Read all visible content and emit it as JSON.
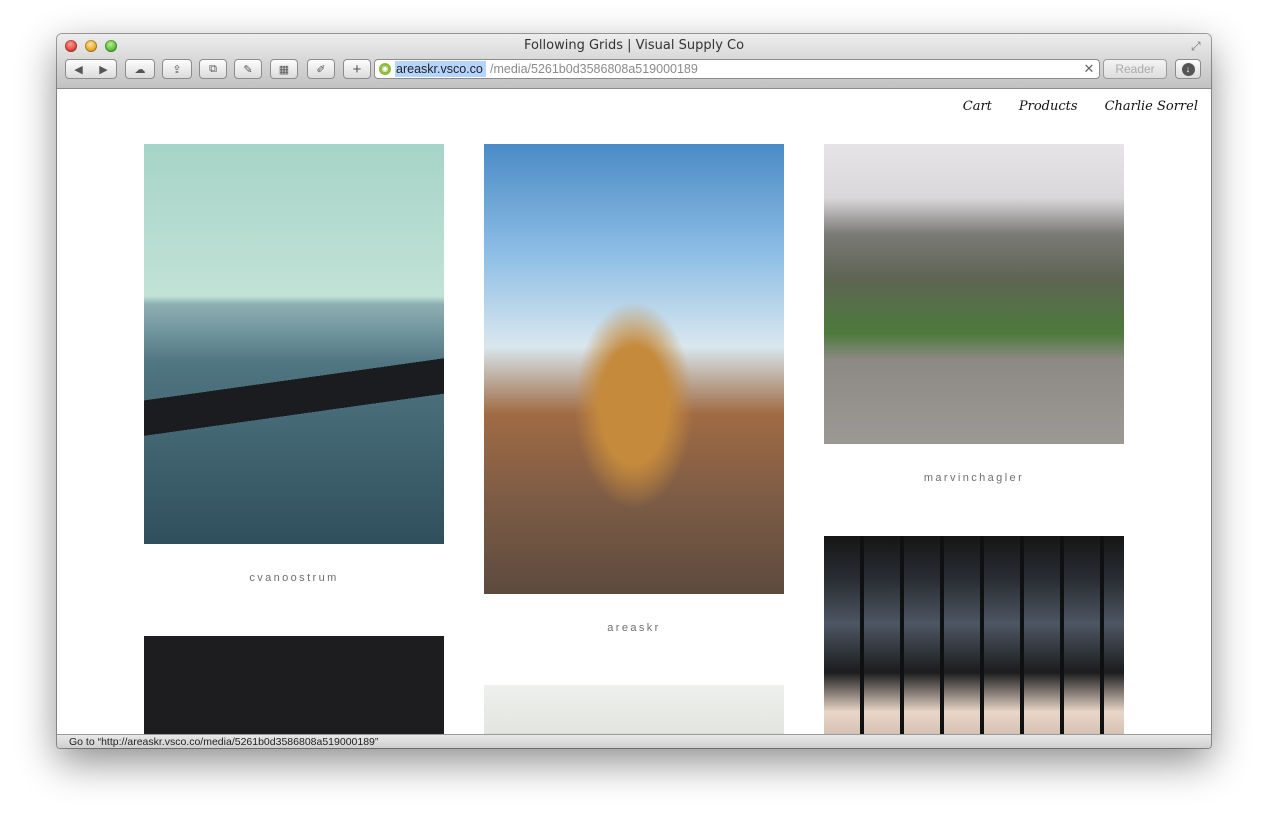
{
  "window": {
    "title": "Following Grids | Visual Supply Co",
    "fullscreen_icon": "fullscreen-icon"
  },
  "toolbar": {
    "back_icon": "◀",
    "forward_icon": "▶",
    "icloud_icon": "☁",
    "share_icon": "⇪",
    "tabs_icon": "⧉",
    "pin_icon": "✎",
    "grid_icon": "▦",
    "edit_icon": "✐",
    "add_icon": "+",
    "address": {
      "host": "areaskr.vsco.co",
      "path": "/media/5261b0d3586808a519000189",
      "clear_icon": "✕"
    },
    "reader_label": "Reader",
    "download_icon": "↓"
  },
  "nav": {
    "items": [
      "Cart",
      "Products",
      "Charlie Sorrel"
    ]
  },
  "grid": {
    "captions": [
      "cvanoostrum",
      "areaskr",
      "marvinchagler"
    ]
  },
  "status": {
    "text": "Go to “http://areaskr.vsco.co/media/5261b0d3586808a519000189”"
  }
}
